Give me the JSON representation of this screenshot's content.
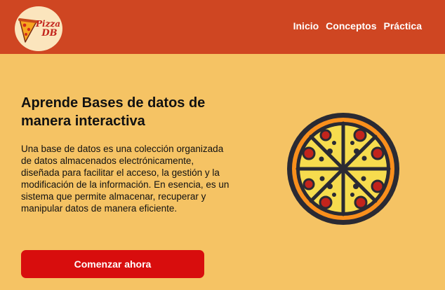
{
  "header": {
    "logo": {
      "line1": "Pizza",
      "line2": "DB"
    },
    "nav": [
      "Inicio",
      "Conceptos",
      "Práctica"
    ]
  },
  "hero": {
    "title": "Aprende Bases de datos de manera interactiva",
    "description": "Una base de datos es una colección organizada de datos almacenados electrónicamente, diseñada para facilitar el acceso, la gestión y la modificación de la información. En esencia, es un sistema que permite almacenar, recuperar y manipular datos de manera eficiente.",
    "cta_label": "Comenzar ahora"
  },
  "colors": {
    "page_background": "#f5c364",
    "header_background": "#cf4622",
    "cta_background": "#d80d0d",
    "logo_text": "#c3251d"
  },
  "icons": {
    "logo": "pizza-slice-icon",
    "illustration": "pizza-icon"
  }
}
